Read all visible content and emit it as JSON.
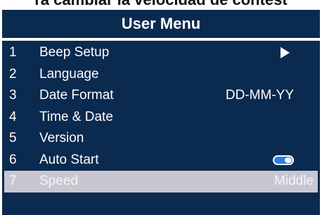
{
  "caption": "ra cambiar la velocidad de contest",
  "menu": {
    "title": "User Menu",
    "items": [
      {
        "number": "1",
        "label": "Beep Setup",
        "value": "",
        "icon": "play-arrow-icon"
      },
      {
        "number": "2",
        "label": "Language",
        "value": ""
      },
      {
        "number": "3",
        "label": "Date Format",
        "value": "DD-MM-YY"
      },
      {
        "number": "4",
        "label": "Time & Date",
        "value": ""
      },
      {
        "number": "5",
        "label": "Version",
        "value": ""
      },
      {
        "number": "6",
        "label": "Auto Start",
        "value": "",
        "icon": "toggle-on-icon",
        "toggle_on": true
      },
      {
        "number": "7",
        "label": "Speed",
        "value": "Middle",
        "selected": true
      }
    ]
  },
  "colors": {
    "panel_background": "#0b2a4f",
    "selected_row": "#c9c6d0",
    "toggle_accent": "#2b7fe0",
    "text": "#ffffff"
  }
}
